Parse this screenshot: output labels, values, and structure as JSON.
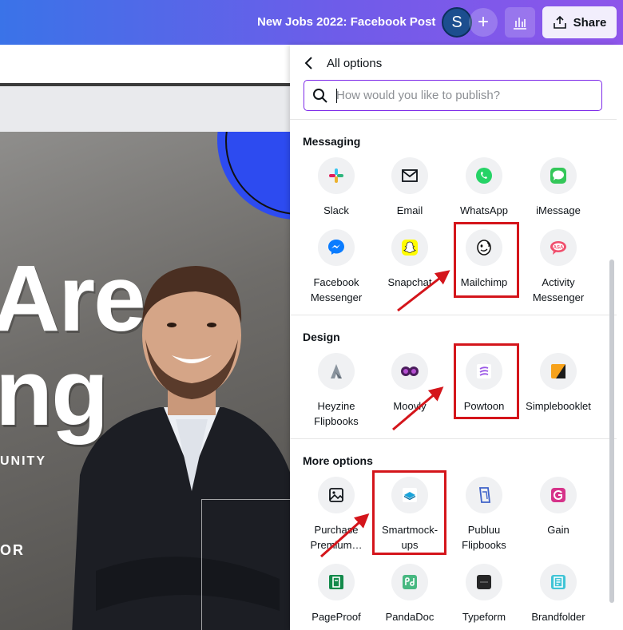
{
  "topbar": {
    "doc_title": "New Jobs 2022: Facebook Post",
    "avatar_letter": "S",
    "add_label": "+",
    "share_label": "Share"
  },
  "canvas": {
    "line1": "Are",
    "line2": "ng",
    "small1": "UNITY",
    "small2": "OR"
  },
  "panel": {
    "back_icon": "chevron-left-icon",
    "title": "All options",
    "search": {
      "value": "",
      "placeholder": "How would you like to publish?"
    },
    "sections": {
      "messaging": {
        "title": "Messaging",
        "items": [
          {
            "label": "Slack",
            "icon": "slack-icon"
          },
          {
            "label": "Email",
            "icon": "envelope-icon"
          },
          {
            "label": "WhatsApp",
            "icon": "whatsapp-icon"
          },
          {
            "label": "iMessage",
            "icon": "imessage-icon"
          },
          {
            "label": "Facebook",
            "label2": "Messenger",
            "icon": "messenger-icon"
          },
          {
            "label": "Snapchat",
            "icon": "snapchat-icon"
          },
          {
            "label": "Mailchimp",
            "icon": "mailchimp-icon"
          },
          {
            "label": "Activity",
            "label2": "Messenger",
            "icon": "activity-messenger-icon"
          }
        ]
      },
      "design": {
        "title": "Design",
        "items": [
          {
            "label": "Heyzine",
            "label2": "Flipbooks",
            "icon": "heyzine-icon"
          },
          {
            "label": "Moovly",
            "icon": "moovly-icon"
          },
          {
            "label": "Powtoon",
            "icon": "powtoon-icon"
          },
          {
            "label": "Simplebooklet",
            "icon": "simplebooklet-icon"
          }
        ]
      },
      "more": {
        "title": "More options",
        "items": [
          {
            "label": "Purchase",
            "label2": "Premium…",
            "icon": "image-icon"
          },
          {
            "label": "Smartmock-",
            "label2": "ups",
            "icon": "smartmockups-icon"
          },
          {
            "label": "Publuu",
            "label2": "Flipbooks",
            "icon": "publuu-icon"
          },
          {
            "label": "Gain",
            "icon": "gain-icon"
          },
          {
            "label": "PageProof",
            "icon": "pageproof-icon"
          },
          {
            "label": "PandaDoc",
            "icon": "pandadoc-icon"
          },
          {
            "label": "Typeform",
            "icon": "typeform-icon"
          },
          {
            "label": "Brandfolder",
            "icon": "brandfolder-icon"
          }
        ]
      }
    }
  },
  "colors": {
    "accent": "#7d2ae8",
    "highlight": "#d4151b",
    "topbar_start": "#3a73e8",
    "topbar_end": "#8e55ea"
  }
}
